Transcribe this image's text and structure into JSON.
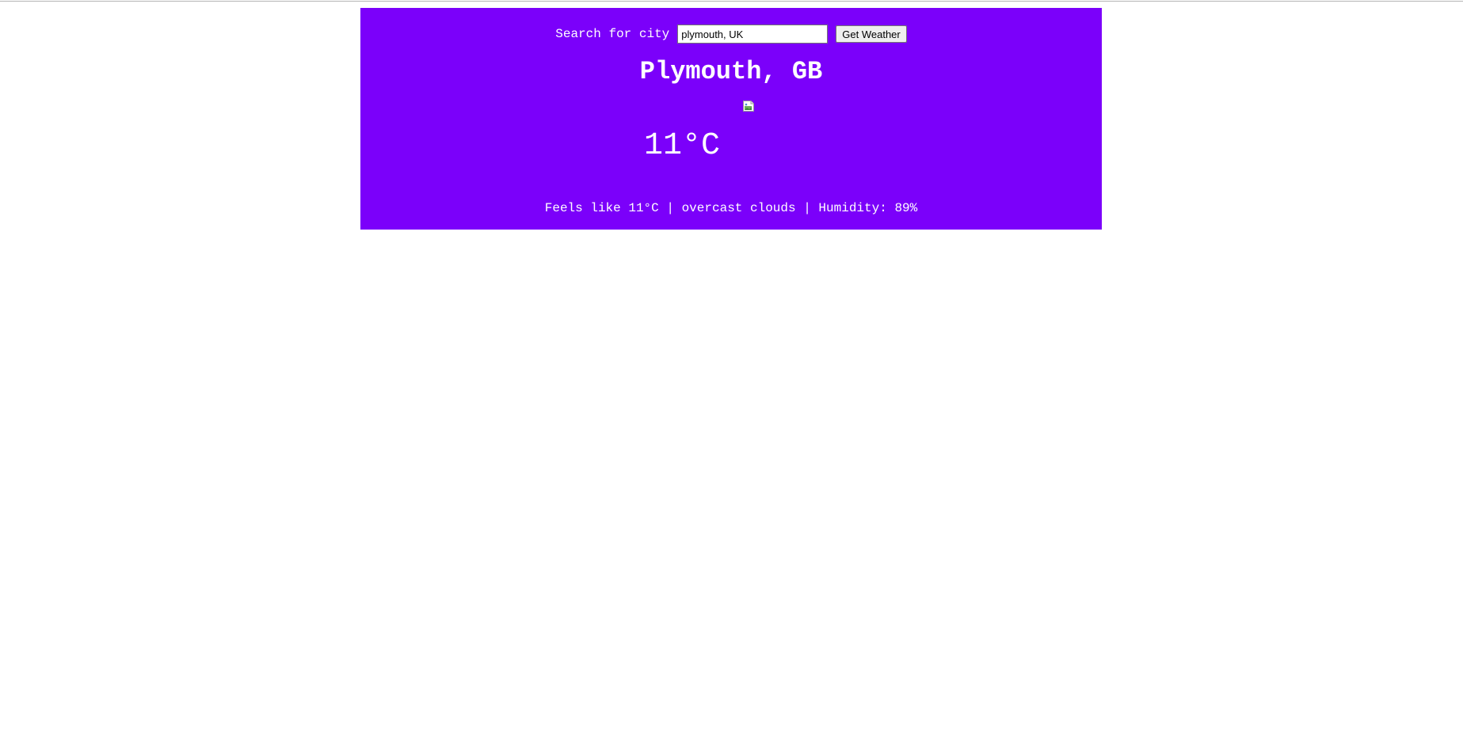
{
  "colors": {
    "card_background": "#7b00fa",
    "card_text": "#ffffff"
  },
  "search": {
    "label": "Search for city",
    "value": "plymouth, UK",
    "button_label": "Get Weather"
  },
  "weather": {
    "location": "Plymouth, GB",
    "icon": "broken-image-icon",
    "temperature": "11°C",
    "details": {
      "feels_like": "Feels like 11°C",
      "separator_1": " | ",
      "description": "overcast clouds",
      "separator_2": " | ",
      "humidity": "Humidity: 89%"
    }
  }
}
